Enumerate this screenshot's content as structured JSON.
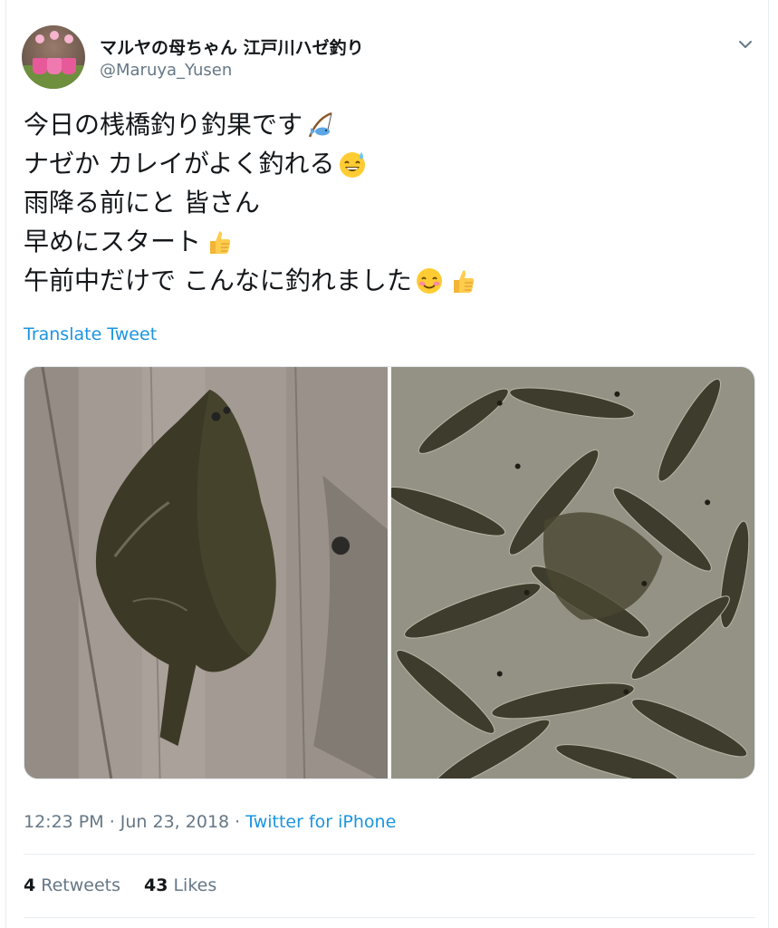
{
  "user": {
    "display_name": "マルヤの母ちゃん 江戸川ハゼ釣り",
    "handle": "@Maruya_Yusen"
  },
  "tweet": {
    "lines": [
      {
        "text": "今日の桟橋釣り釣果です",
        "emoji": [
          "fishing-pole-emoji"
        ]
      },
      {
        "text": "ナゼか カレイがよく釣れる",
        "emoji": [
          "sweat-smile-emoji"
        ]
      },
      {
        "text": "雨降る前にと 皆さん",
        "emoji": []
      },
      {
        "text": "早めにスタート",
        "emoji": [
          "thumbs-up-emoji"
        ]
      },
      {
        "text": "午前中だけで こんなに釣れました",
        "emoji": [
          "blush-emoji",
          "thumbs-up-emoji"
        ]
      }
    ],
    "translate_label": "Translate Tweet"
  },
  "media": {
    "photos": [
      "flounder-on-wooden-pier",
      "bucket-of-goby-fish"
    ]
  },
  "meta": {
    "time": "12:23 PM",
    "sep1": " · ",
    "date": "Jun 23, 2018",
    "sep2": " · ",
    "source": "Twitter for iPhone"
  },
  "stats": {
    "retweets_count": "4",
    "retweets_label": "Retweets",
    "likes_count": "43",
    "likes_label": "Likes"
  },
  "colors": {
    "link": "#1b95e0",
    "secondary_text": "#657786",
    "primary_text": "#14171a",
    "divider": "#e6ecf0"
  }
}
